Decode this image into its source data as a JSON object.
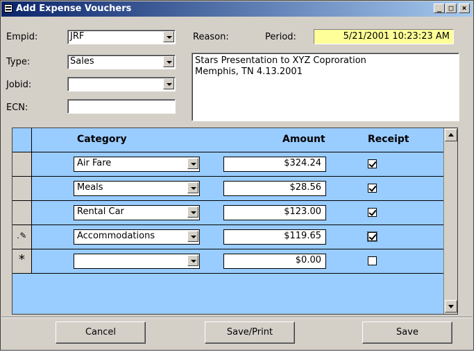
{
  "window": {
    "title": "Add Expense Vouchers",
    "minimize": "_",
    "maximize": "□",
    "close": "×"
  },
  "form": {
    "empid_label": "Empid:",
    "empid_value": "JRF",
    "type_label": "Type:",
    "type_value": "Sales",
    "jobid_label": "Jobid:",
    "jobid_value": "",
    "ecn_label": "ECN:",
    "ecn_value": "",
    "reason_label": "Reason:",
    "period_label": "Period:",
    "period_value": "5/21/2001 10:23:23 AM",
    "reason_line1": "Stars Presentation to XYZ Coproration",
    "reason_line2": "Memphis, TN 4.13.2001"
  },
  "grid": {
    "headers": {
      "category": "Category",
      "amount": "Amount",
      "receipt": "Receipt"
    },
    "rows": [
      {
        "selector": "",
        "category": "Air Fare",
        "amount": "$324.24",
        "receipt": true
      },
      {
        "selector": "",
        "category": "Meals",
        "amount": "$28.56",
        "receipt": true
      },
      {
        "selector": "",
        "category": "Rental Car",
        "amount": "$123.00",
        "receipt": true
      },
      {
        "selector": "pencil",
        "category": "Accommodations",
        "amount": "$119.65",
        "receipt": true
      },
      {
        "selector": "*",
        "category": "",
        "amount": "$0.00",
        "receipt": false
      }
    ]
  },
  "buttons": {
    "cancel": "Cancel",
    "save_print": "Save/Print",
    "save": "Save"
  },
  "colors": {
    "grid_background": "#99ccff",
    "period_background": "#ffff99",
    "title_bar": "#0a246a"
  }
}
